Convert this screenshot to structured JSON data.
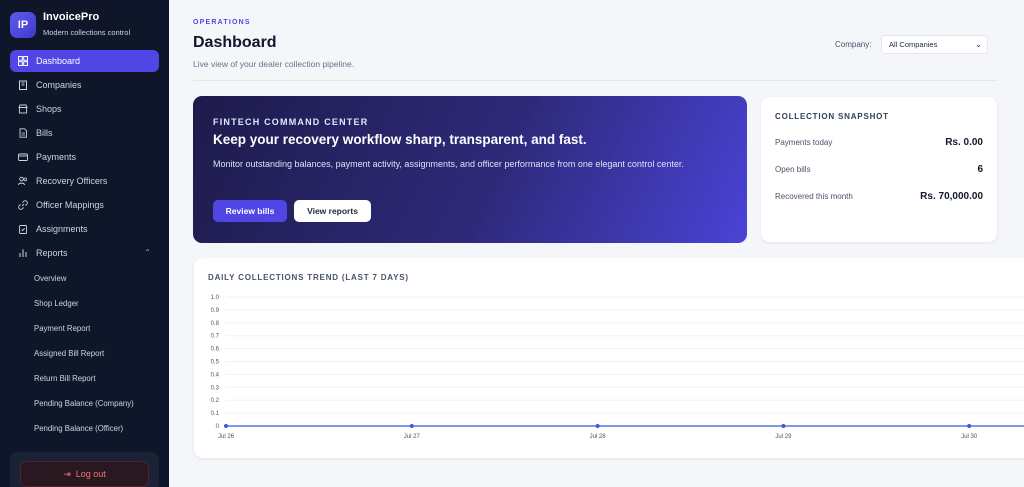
{
  "brand": {
    "logo": "IP",
    "name": "InvoicePro",
    "tagline": "Modern collections control"
  },
  "sidebar": {
    "items": [
      {
        "label": "Dashboard",
        "icon": "grid-icon",
        "active": true
      },
      {
        "label": "Companies",
        "icon": "building-icon"
      },
      {
        "label": "Shops",
        "icon": "store-icon"
      },
      {
        "label": "Bills",
        "icon": "document-icon"
      },
      {
        "label": "Payments",
        "icon": "card-icon"
      },
      {
        "label": "Recovery Officers",
        "icon": "users-icon"
      },
      {
        "label": "Officer Mappings",
        "icon": "link-icon"
      },
      {
        "label": "Assignments",
        "icon": "clipboard-icon"
      },
      {
        "label": "Reports",
        "icon": "bar-chart-icon",
        "expanded": true
      }
    ],
    "report_items": [
      {
        "label": "Overview"
      },
      {
        "label": "Shop Ledger"
      },
      {
        "label": "Payment Report"
      },
      {
        "label": "Assigned Bill Report"
      },
      {
        "label": "Return Bill Report"
      },
      {
        "label": "Pending Balance (Company)"
      },
      {
        "label": "Pending Balance (Officer)"
      }
    ],
    "logout_label": "Log out"
  },
  "header": {
    "eyebrow": "OPERATIONS",
    "title": "Dashboard",
    "subtitle": "Live view of your dealer collection pipeline.",
    "company_label": "Company:",
    "company_selected": "All Companies"
  },
  "hero": {
    "eyebrow": "FINTECH COMMAND CENTER",
    "title": "Keep your recovery workflow sharp, transparent, and fast.",
    "description": "Monitor outstanding balances, payment activity, assignments, and officer performance from one elegant control center.",
    "primary_button": "Review bills",
    "secondary_button": "View reports"
  },
  "snapshot": {
    "title": "COLLECTION SNAPSHOT",
    "rows": [
      {
        "label": "Payments today",
        "value": "Rs. 0.00"
      },
      {
        "label": "Open bills",
        "value": "6"
      },
      {
        "label": "Recovered this month",
        "value": "Rs. 70,000.00"
      }
    ]
  },
  "chart": {
    "title": "DAILY COLLECTIONS TREND (LAST 7 DAYS)"
  },
  "chart_data": {
    "type": "line",
    "x": [
      "Jul 26",
      "Jul 27",
      "Jul 28",
      "Jul 29",
      "Jul 30"
    ],
    "series": [
      {
        "values": [
          0,
          0,
          0,
          0,
          0
        ]
      }
    ],
    "ylim": [
      0,
      1
    ],
    "yticks": [
      "0",
      "0.1",
      "0.2",
      "0.3",
      "0.4",
      "0.5",
      "0.6",
      "0.7",
      "0.8",
      "0.9",
      "1.0"
    ],
    "grid": true,
    "color": "#3b5bdb"
  }
}
